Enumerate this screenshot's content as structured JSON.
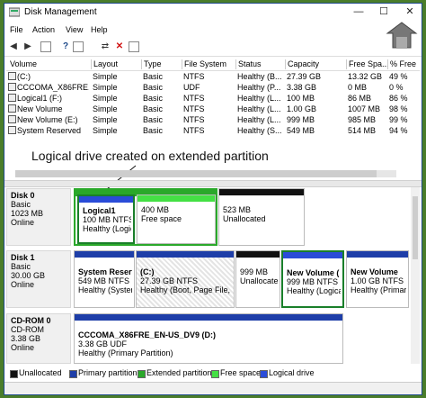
{
  "window": {
    "title": "Disk Management",
    "controls": {
      "minimize": "—",
      "maximize": "☐",
      "close": "✕"
    }
  },
  "menu": [
    "File",
    "Action",
    "View",
    "Help"
  ],
  "toolbar_icons": [
    "back-icon",
    "forward-icon",
    "grid-icon",
    "help-icon",
    "list-icon",
    "connect-icon",
    "delete-icon",
    "properties-icon"
  ],
  "volume_columns": [
    "Volume",
    "Layout",
    "Type",
    "File System",
    "Status",
    "Capacity",
    "Free Spa...",
    "% Free"
  ],
  "volumes": [
    {
      "volume": "(C:)",
      "layout": "Simple",
      "type": "Basic",
      "fs": "NTFS",
      "status": "Healthy (B...",
      "capacity": "27.39 GB",
      "free": "13.32 GB",
      "pct": "49 %"
    },
    {
      "volume": "CCCOMA_X86FRE...",
      "layout": "Simple",
      "type": "Basic",
      "fs": "UDF",
      "status": "Healthy (P...",
      "capacity": "3.38 GB",
      "free": "0 MB",
      "pct": "0 %"
    },
    {
      "volume": "Logical1 (F:)",
      "layout": "Simple",
      "type": "Basic",
      "fs": "NTFS",
      "status": "Healthy (L...",
      "capacity": "100 MB",
      "free": "86 MB",
      "pct": "86 %"
    },
    {
      "volume": "New Volume",
      "layout": "Simple",
      "type": "Basic",
      "fs": "NTFS",
      "status": "Healthy (L...",
      "capacity": "1.00 GB",
      "free": "1007 MB",
      "pct": "98 %"
    },
    {
      "volume": "New Volume (E:)",
      "layout": "Simple",
      "type": "Basic",
      "fs": "NTFS",
      "status": "Healthy (L...",
      "capacity": "999 MB",
      "free": "985 MB",
      "pct": "99 %"
    },
    {
      "volume": "System Reserved",
      "layout": "Simple",
      "type": "Basic",
      "fs": "NTFS",
      "status": "Healthy (S...",
      "capacity": "549 MB",
      "free": "514 MB",
      "pct": "94 %"
    }
  ],
  "annotation": "Logical drive created on extended partition",
  "disks": [
    {
      "name": "Disk 0",
      "type": "Basic",
      "size": "1023 MB",
      "state": "Online"
    },
    {
      "name": "Disk 1",
      "type": "Basic",
      "size": "30.00 GB",
      "state": "Online"
    },
    {
      "name": "CD-ROM 0",
      "type": "CD-ROM",
      "size": "3.38 GB",
      "state": "Online"
    }
  ],
  "partitions": {
    "d0_logical1": {
      "name": "Logical1",
      "size": "100 MB NTFS",
      "status": "Healthy (Logic"
    },
    "d0_free": {
      "size": "400 MB",
      "status": "Free space"
    },
    "d0_unalloc": {
      "size": "523 MB",
      "status": "Unallocated"
    },
    "d1_sysres": {
      "name": "System Reserv",
      "size": "549 MB NTFS",
      "status": "Healthy (Syster"
    },
    "d1_c": {
      "name": "(C:)",
      "size": "27.39 GB NTFS",
      "status": "Healthy (Boot, Page File, C"
    },
    "d1_unalloc": {
      "size": "999 MB",
      "status": "Unallocated"
    },
    "d1_newvol": {
      "name": "New Volume  (",
      "size": "999 MB NTFS",
      "status": "Healthy (Logica"
    },
    "d1_newvol2": {
      "name": "New Volume",
      "size": "1.00 GB NTFS",
      "status": "Healthy (Primary"
    },
    "cd": {
      "name": "CCCOMA_X86FRE_EN-US_DV9  (D:)",
      "size": "3.38 GB UDF",
      "status": "Healthy (Primary Partition)"
    }
  },
  "legend": [
    "Unallocated",
    "Primary partition",
    "Extended partition",
    "Free space",
    "Logical drive"
  ],
  "colors": {
    "unallocated": "#111111",
    "primary": "#1e3ea8",
    "extended": "#2aa82a",
    "free": "#44e044",
    "logical": "#2a4cd8",
    "selection": "#1a7f2a"
  }
}
